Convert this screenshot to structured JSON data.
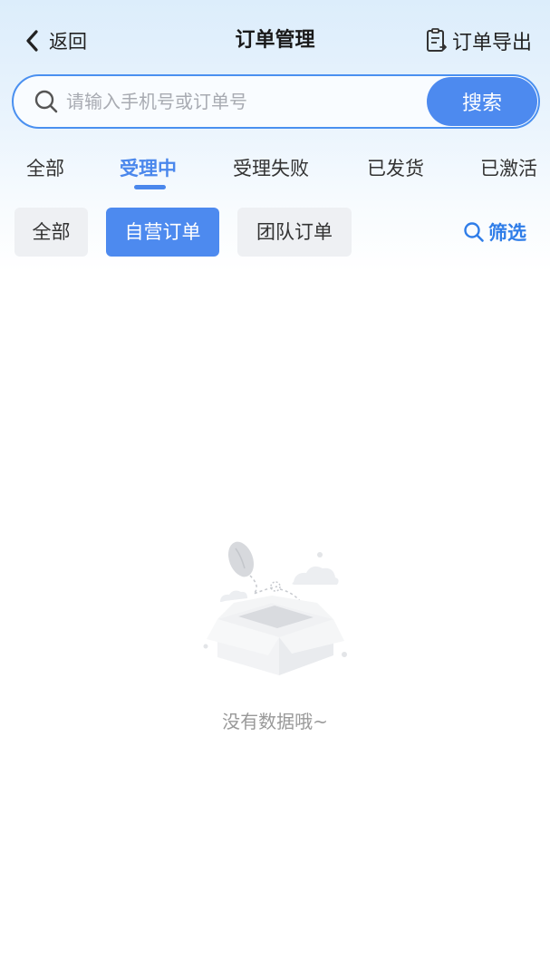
{
  "header": {
    "back_label": "返回",
    "title": "订单管理",
    "export_label": "订单导出"
  },
  "search": {
    "placeholder": "请输入手机号或订单号",
    "value": "",
    "button_label": "搜索"
  },
  "status_tabs": [
    {
      "label": "全部",
      "active": false
    },
    {
      "label": "受理中",
      "active": true
    },
    {
      "label": "受理失败",
      "active": false
    },
    {
      "label": "已发货",
      "active": false
    },
    {
      "label": "已激活",
      "active": false
    }
  ],
  "filter_chips": [
    {
      "label": "全部",
      "active": false
    },
    {
      "label": "自营订单",
      "active": true
    },
    {
      "label": "团队订单",
      "active": false
    }
  ],
  "filter_label": "筛选",
  "empty_state": {
    "text": "没有数据哦~",
    "icon": "empty-box-icon"
  },
  "colors": {
    "accent": "#4d8aef",
    "tab_active": "#4a87ec",
    "filter_link": "#2f7de8",
    "chip_bg": "#eef0f3",
    "empty_text": "#999999"
  }
}
